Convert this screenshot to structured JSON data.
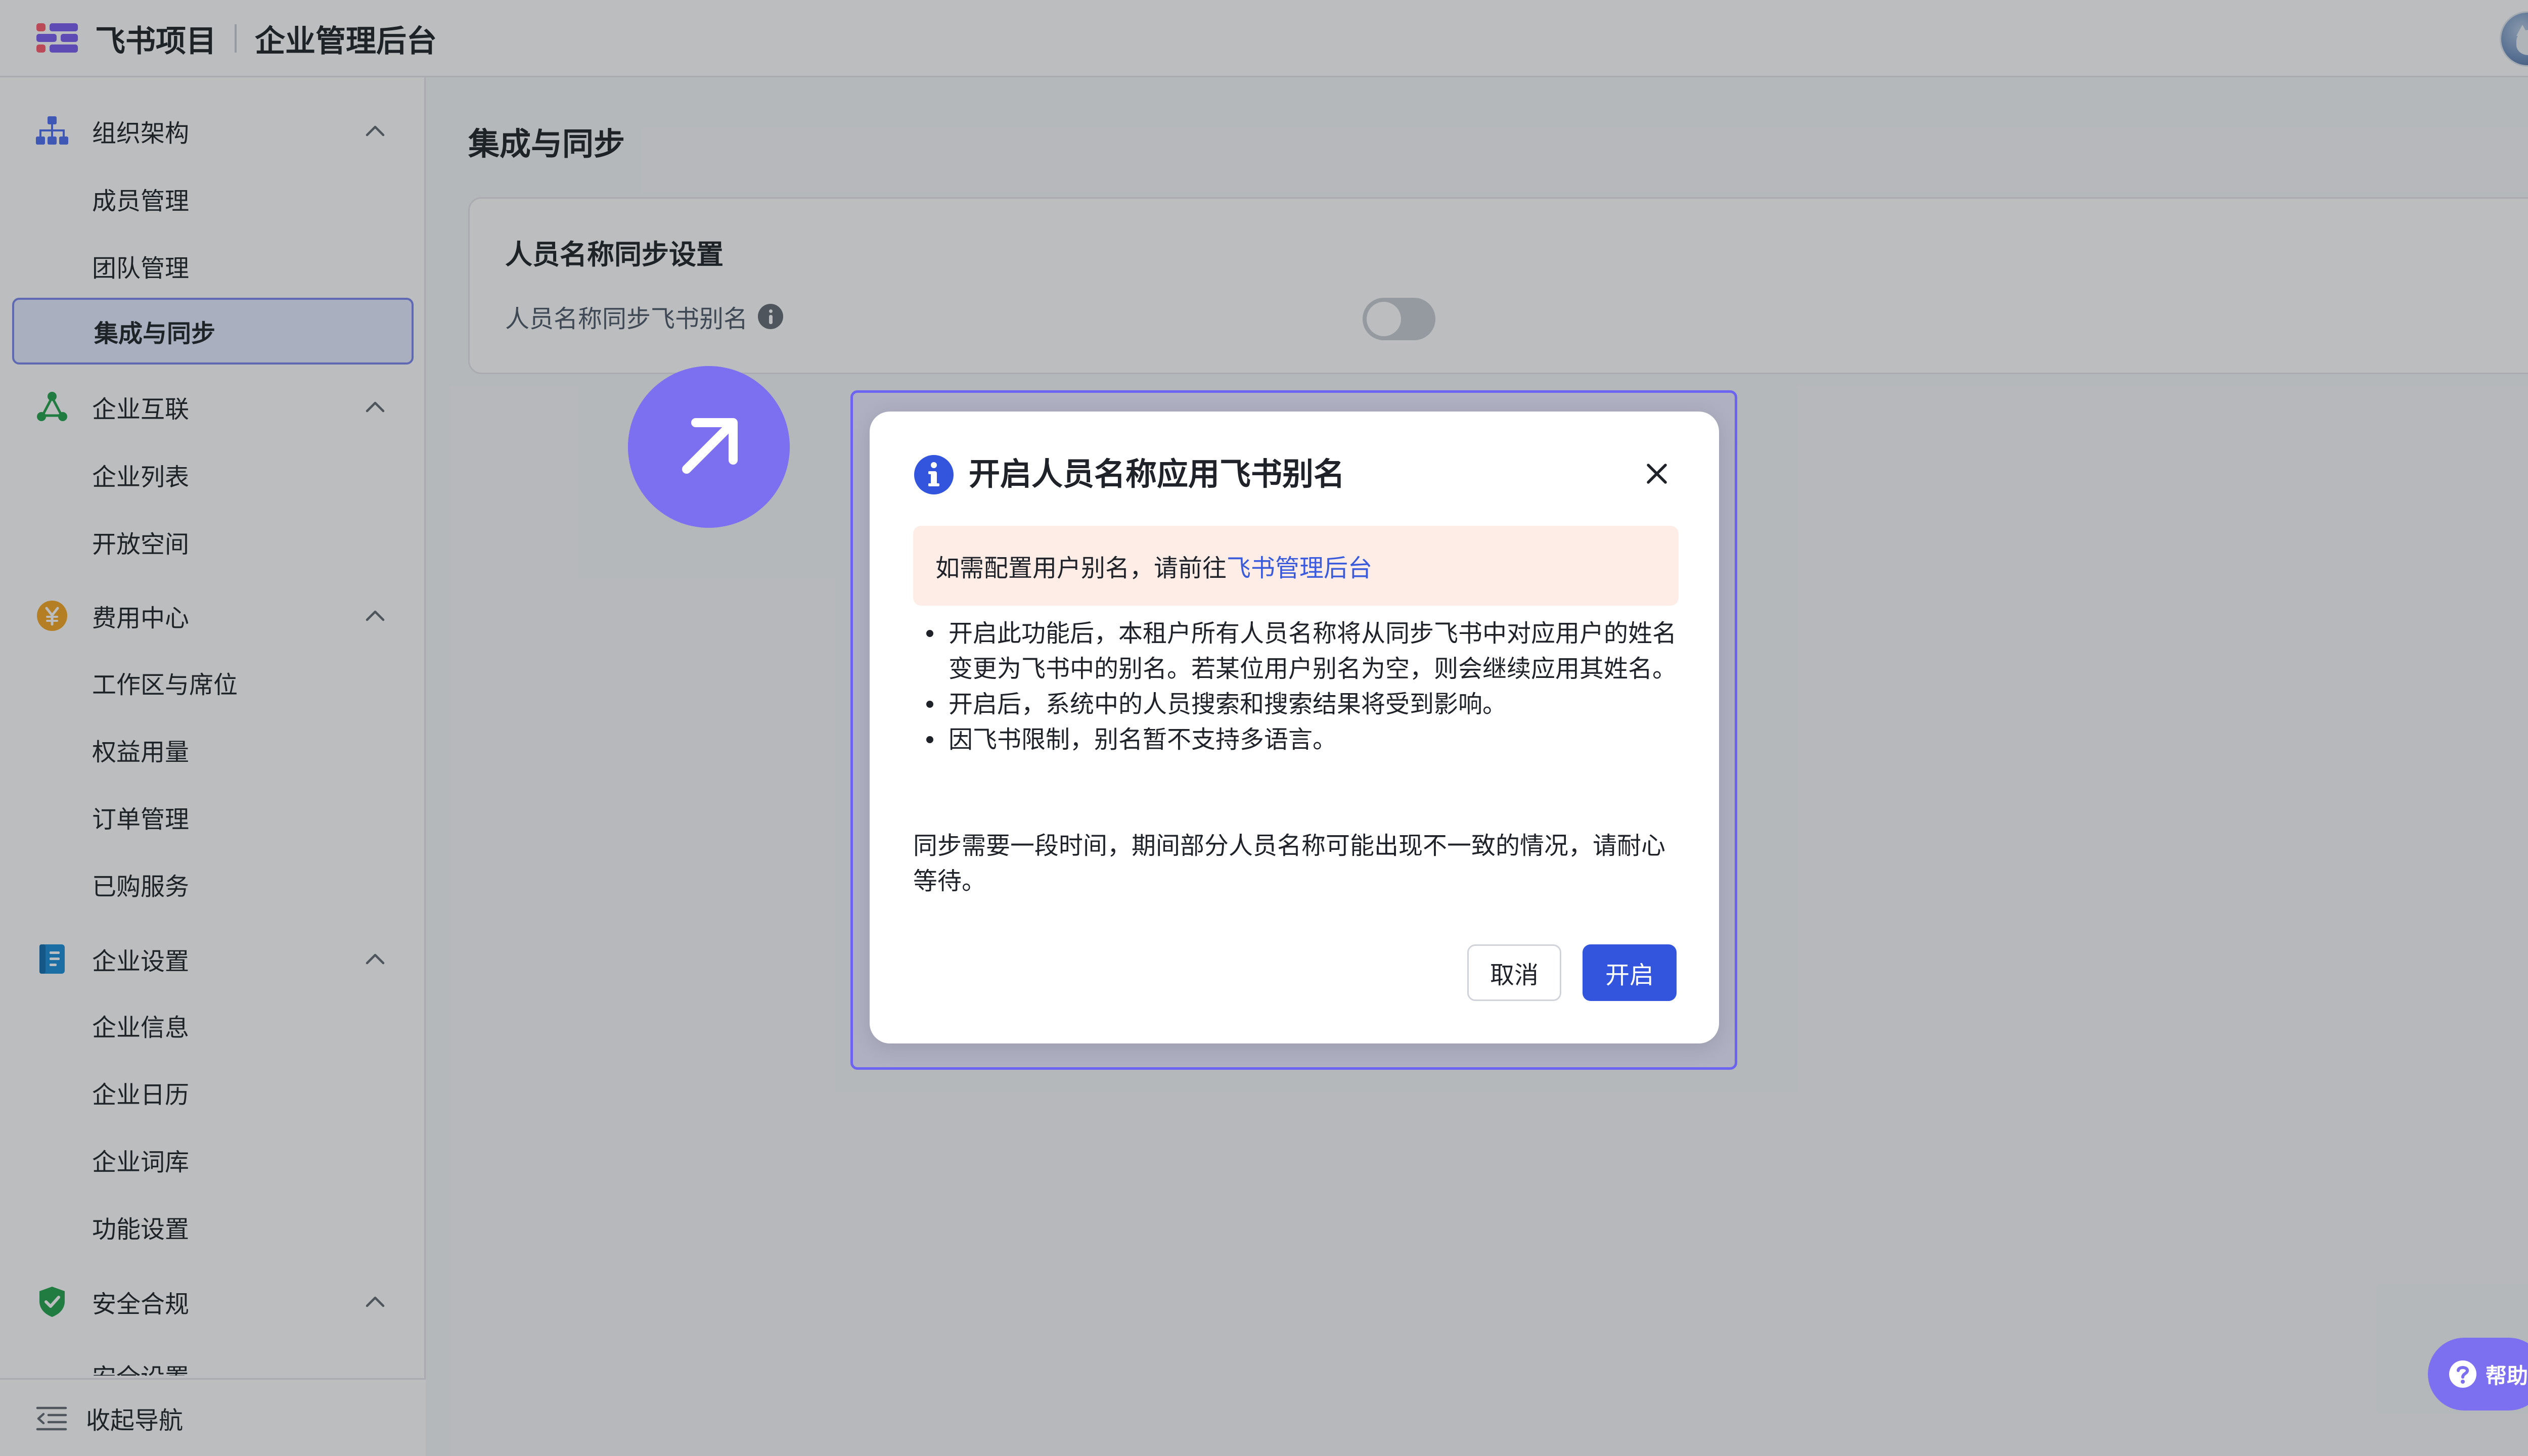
{
  "header": {
    "product": "飞书项目",
    "section": "企业管理后台"
  },
  "sidebar": {
    "groups": [
      {
        "label": "组织架构",
        "items": [
          "成员管理",
          "团队管理",
          "集成与同步"
        ]
      },
      {
        "label": "企业互联",
        "items": [
          "企业列表",
          "开放空间"
        ]
      },
      {
        "label": "费用中心",
        "items": [
          "工作区与席位",
          "权益用量",
          "订单管理",
          "已购服务"
        ]
      },
      {
        "label": "企业设置",
        "items": [
          "企业信息",
          "企业日历",
          "企业词库",
          "功能设置"
        ]
      },
      {
        "label": "安全合规",
        "items": [
          "安全设置"
        ]
      }
    ],
    "active_item": "集成与同步",
    "collapse_label": "收起导航"
  },
  "main": {
    "title": "集成与同步",
    "card": {
      "title": "人员名称同步设置",
      "setting_label": "人员名称同步飞书别名",
      "toggle_on": false
    }
  },
  "dialog": {
    "title": "开启人员名称应用飞书别名",
    "notice_prefix": "如需配置用户别名，请前往",
    "notice_link": "飞书管理后台",
    "bullets": [
      "开启此功能后，本租户所有人员名称将从同步飞书中对应用户的姓名变更为飞书中的别名。若某位用户别名为空，则会继续应用其姓名。",
      "开启后，系统中的人员搜索和搜索结果将受到影响。",
      "因飞书限制，别名暂不支持多语言。"
    ],
    "note": "同步需要一段时间，期间部分人员名称可能出现不一致的情况，请耐心等待。",
    "cancel_label": "取消",
    "confirm_label": "开启"
  },
  "help": {
    "label": "帮助"
  },
  "colors": {
    "primary": "#3355dd",
    "link": "#3a5bdb",
    "accent_bubble": "#7c6ff0",
    "notice_bg": "#fdede6",
    "active_nav_bg": "#e6ebff"
  }
}
